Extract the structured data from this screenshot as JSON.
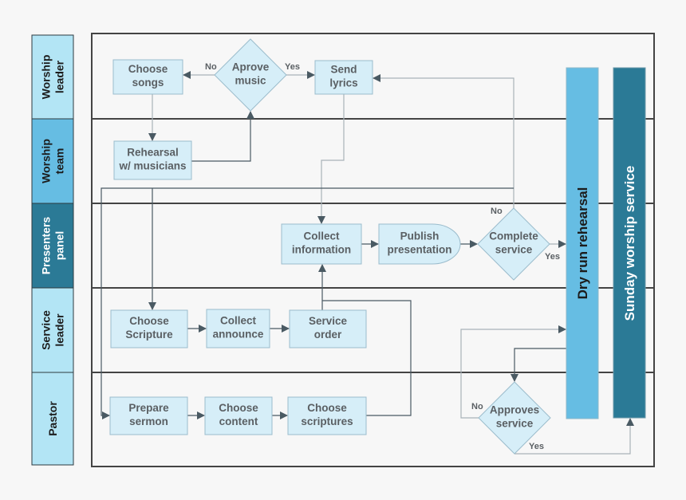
{
  "colors": {
    "lane_light": "#b3e5f5",
    "lane_mid": "#66bde3",
    "lane_dark": "#2b7a96",
    "node_fill": "#d6eef8",
    "node_stroke": "#9bbccc",
    "line": "#4a5a63"
  },
  "lanes": [
    {
      "id": "worship-leader",
      "lines": [
        "Worship",
        "leader"
      ]
    },
    {
      "id": "worship-team",
      "lines": [
        "Worship",
        "team"
      ]
    },
    {
      "id": "presenters-panel",
      "lines": [
        "Presenters",
        "panel"
      ]
    },
    {
      "id": "service-leader",
      "lines": [
        "Service",
        "leader"
      ]
    },
    {
      "id": "pastor",
      "lines": [
        "Pastor"
      ]
    }
  ],
  "nodes": {
    "choose_songs": [
      "Choose",
      "songs"
    ],
    "aprove_music": [
      "Aprove",
      "music"
    ],
    "send_lyrics": [
      "Send",
      "lyrics"
    ],
    "rehearsal": [
      "Rehearsal",
      "w/ musicians"
    ],
    "collect_information": [
      "Collect",
      "information"
    ],
    "publish_presentation": [
      "Publish",
      "presentation"
    ],
    "complete_service": [
      "Complete",
      "service"
    ],
    "choose_scripture": [
      "Choose",
      "Scripture"
    ],
    "collect_announce": [
      "Collect",
      "announce"
    ],
    "service_order": [
      "Service",
      "order"
    ],
    "prepare_sermon": [
      "Prepare",
      "sermon"
    ],
    "choose_content": [
      "Choose",
      "content"
    ],
    "choose_scriptures": [
      "Choose",
      "scriptures"
    ],
    "approves_service": [
      "Approves",
      "service"
    ]
  },
  "bars": {
    "dry_run": "Dry run rehearsal",
    "sunday": "Sunday worship service"
  },
  "edge_labels": {
    "no": "No",
    "yes": "Yes"
  }
}
